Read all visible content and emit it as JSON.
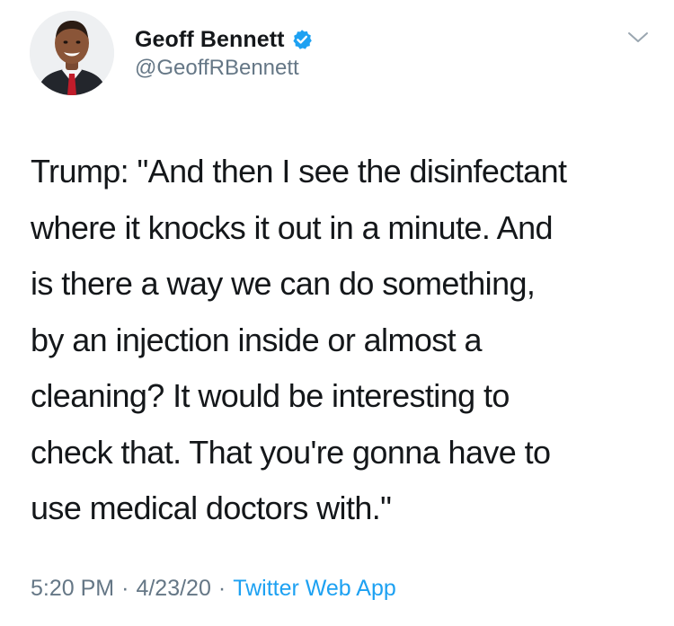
{
  "user": {
    "display_name": "Geoff Bennett",
    "handle": "@GeoffRBennett",
    "verified": true
  },
  "icons": {
    "verified": "verified-badge-icon",
    "more": "chevron-down-icon"
  },
  "tweet": {
    "text": "Trump: \"And then I see the disinfectant\nwhere it knocks it out in a minute. And\nis there a way we can do something,\nby an injection inside or almost a\ncleaning? It would be interesting to\ncheck that. That you're gonna have to\nuse medical doctors with.\""
  },
  "meta": {
    "time": "5:20 PM",
    "separator": "·",
    "date": "4/23/20",
    "source": "Twitter Web App"
  },
  "colors": {
    "text": "#14171a",
    "muted": "#657786",
    "accent": "#1da1f2"
  }
}
